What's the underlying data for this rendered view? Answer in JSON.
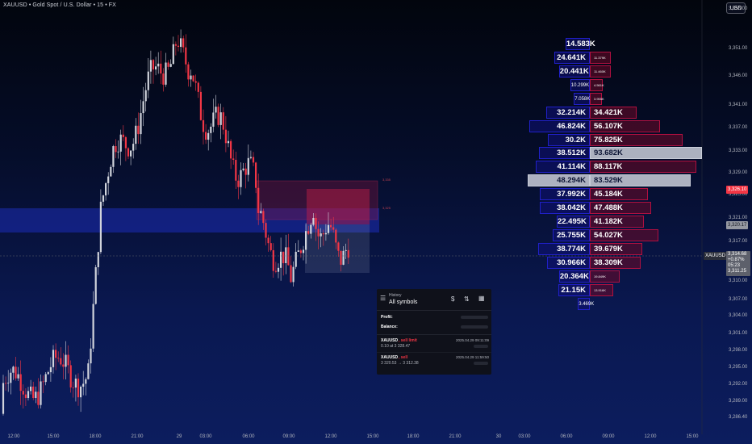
{
  "header": {
    "symbol_title": "XAUUSD • Gold Spot / U.S. Dollar • 15 • FX",
    "currency": "USD"
  },
  "colors": {
    "up_candle": "#d1d4dc",
    "down_candle": "#f23645",
    "volume_left_border": "#2020c8",
    "volume_right_border": "#b01040",
    "current_price_bg": "#5d606b",
    "red_tag_bg": "#f23645"
  },
  "price_axis": {
    "labels": [
      "3,356.00",
      "3,351.00",
      "3,346.00",
      "3,341.00",
      "3,337.00",
      "3,333.00",
      "3,329.00",
      "3,325.00",
      "3,321.00",
      "3,317.00",
      "3,313.00",
      "3,310.00",
      "3,307.00",
      "3,304.00",
      "3,301.00",
      "3,298.00",
      "3,295.00",
      "3,292.00",
      "3,289.00",
      "3,286.40"
    ],
    "tags": {
      "red_price": "3,326.10",
      "gray_price": "3,320.17",
      "symbol_label": "XAUUSD",
      "current_price": "3,314.68",
      "change_pct": "+0.87%",
      "countdown": "05:23",
      "below_price": "3,311.25"
    }
  },
  "time_axis": {
    "labels": [
      "12:00",
      "15:00",
      "18:00",
      "21:00",
      "29",
      "03:00",
      "06:00",
      "09:00",
      "12:00",
      "15:00",
      "18:00",
      "21:00",
      "30",
      "03:00",
      "06:00",
      "09:00",
      "12:00",
      "15:00"
    ]
  },
  "volume_profile": {
    "rows": [
      {
        "left": "14.583K",
        "right": ""
      },
      {
        "left": "24.641K",
        "right": "11.379K"
      },
      {
        "left": "20.441K",
        "right": "11.460K"
      },
      {
        "left": "10.299K",
        "right": "4.561K"
      },
      {
        "left": "7.058K",
        "right": "3.955K"
      },
      {
        "left": "32.214K",
        "right": "34.421K"
      },
      {
        "left": "46.824K",
        "right": "56.107K"
      },
      {
        "left": "30.2K",
        "right": "75.825K"
      },
      {
        "left": "38.512K",
        "right": "93.682K"
      },
      {
        "left": "41.114K",
        "right": "88.117K"
      },
      {
        "left": "48.294K",
        "right": "83.529K"
      },
      {
        "left": "37.992K",
        "right": "45.184K"
      },
      {
        "left": "38.042K",
        "right": "47.488K"
      },
      {
        "left": "22.495K",
        "right": "41.182K"
      },
      {
        "left": "25.755K",
        "right": "54.027K"
      },
      {
        "left": "38.774K",
        "right": "39.679K"
      },
      {
        "left": "30.966K",
        "right": "38.309K"
      },
      {
        "left": "20.364K",
        "right": "19.849K"
      },
      {
        "left": "21.15K",
        "right": "13.916K"
      },
      {
        "left": "3.469K",
        "right": ""
      }
    ]
  },
  "history_panel": {
    "heading": "History",
    "filter": "All symbols",
    "profit_label": "Profit:",
    "balance_label": "Balance:",
    "trades": [
      {
        "symbol": "XAUUSD",
        "side": ", sell limit",
        "detail": "0.10 at 3 328.47",
        "time": "2025.04.29 09:11:09"
      },
      {
        "symbol": "XAUUSD",
        "side": ", sell",
        "detail": "3 320.53 → 3 312.38",
        "time": "2025.04.29 11:59:50"
      }
    ]
  },
  "annotations": {
    "upper": "3,335",
    "lower": "3,325"
  }
}
